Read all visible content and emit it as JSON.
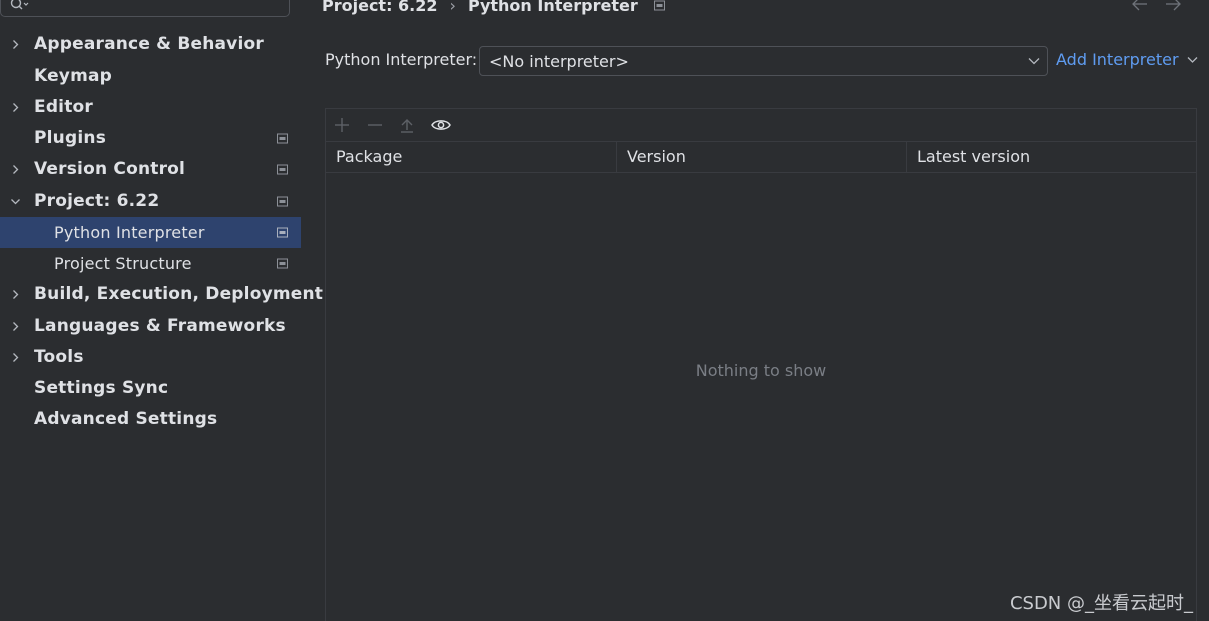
{
  "sidebar": {
    "search_placeholder": "",
    "items": [
      {
        "label": "Appearance & Behavior",
        "expandable": true,
        "expanded": false,
        "module_icon": false
      },
      {
        "label": "Keymap",
        "expandable": false,
        "module_icon": false
      },
      {
        "label": "Editor",
        "expandable": true,
        "expanded": false,
        "module_icon": false
      },
      {
        "label": "Plugins",
        "expandable": false,
        "module_icon": true
      },
      {
        "label": "Version Control",
        "expandable": true,
        "expanded": false,
        "module_icon": true
      },
      {
        "label": "Project: 6.22",
        "expandable": true,
        "expanded": true,
        "module_icon": true
      },
      {
        "label": "Python Interpreter",
        "child": true,
        "selected": true,
        "module_icon": true
      },
      {
        "label": "Project Structure",
        "child": true,
        "module_icon": true
      },
      {
        "label": "Build, Execution, Deployment",
        "expandable": true,
        "expanded": false,
        "module_icon": false
      },
      {
        "label": "Languages & Frameworks",
        "expandable": true,
        "expanded": false,
        "module_icon": false
      },
      {
        "label": "Tools",
        "expandable": true,
        "expanded": false,
        "module_icon": false
      },
      {
        "label": "Settings Sync",
        "expandable": false,
        "module_icon": false
      },
      {
        "label": "Advanced Settings",
        "expandable": false,
        "module_icon": false
      }
    ]
  },
  "breadcrumb": {
    "parent": "Project: 6.22",
    "separator": "›",
    "current": "Python Interpreter"
  },
  "interpreter": {
    "label": "Python Interpreter:",
    "selected": "<No interpreter>",
    "add_label": "Add Interpreter"
  },
  "packages": {
    "toolbar": [
      "add-icon",
      "remove-icon",
      "upgrade-icon",
      "eye-icon"
    ],
    "columns": [
      "Package",
      "Version",
      "Latest version"
    ],
    "rows": [],
    "empty_text": "Nothing to show"
  },
  "watermark": "CSDN @_坐看云起时_",
  "colors": {
    "background": "#2b2d30",
    "selection": "#2e436e",
    "link": "#5f9cf1",
    "text": "#dfe1e5",
    "muted": "#7a7e85"
  }
}
